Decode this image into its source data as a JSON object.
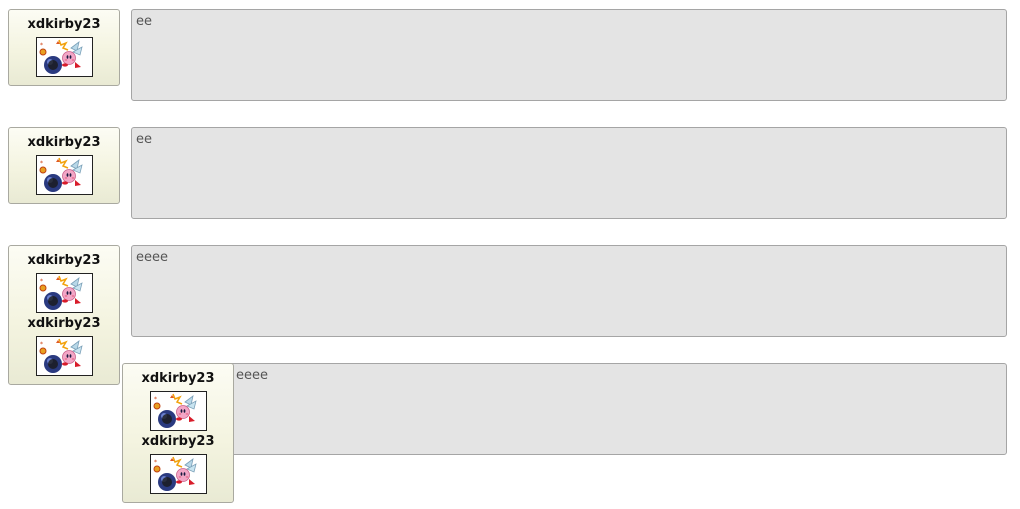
{
  "posts": [
    {
      "message": "ee"
    },
    {
      "message": "ee"
    },
    {
      "message": "eeee"
    },
    {
      "message": "eeee"
    }
  ],
  "cards": [
    {
      "users": [
        {
          "username": "xdkirby23",
          "avatar_icon": "kirby-bomb-avatar-icon"
        }
      ]
    },
    {
      "users": [
        {
          "username": "xdkirby23",
          "avatar_icon": "kirby-bomb-avatar-icon"
        }
      ]
    },
    {
      "users": [
        {
          "username": "xdkirby23",
          "avatar_icon": "kirby-bomb-avatar-icon"
        },
        {
          "username": "xdkirby23",
          "avatar_icon": "kirby-bomb-avatar-icon"
        }
      ]
    },
    {
      "users": [
        {
          "username": "xdkirby23",
          "avatar_icon": "kirby-bomb-avatar-icon"
        },
        {
          "username": "xdkirby23",
          "avatar_icon": "kirby-bomb-avatar-icon"
        }
      ]
    }
  ],
  "colors": {
    "card_bg": "#f4f4e0",
    "message_bg": "#e4e4e4",
    "border": "#a5a5a5"
  }
}
